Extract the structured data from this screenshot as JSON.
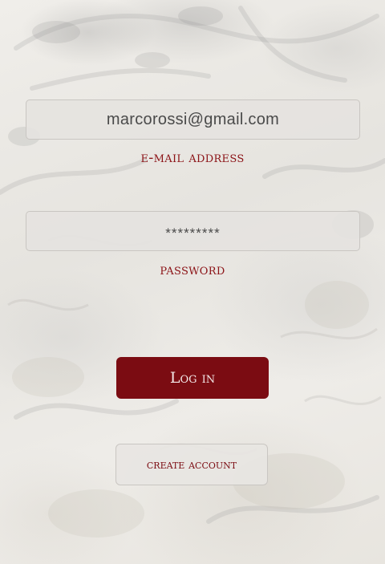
{
  "login_form": {
    "email_value": "marcorossi@gmail.com",
    "email_label": "e-mail address",
    "password_value": "*********",
    "password_label": "password",
    "login_button_label": "Log in",
    "create_account_label": "create account"
  },
  "colors": {
    "accent": "#7b0c12",
    "label_text": "#8b1216",
    "field_bg": "#e5e3e0",
    "page_bg": "#eceae6"
  }
}
